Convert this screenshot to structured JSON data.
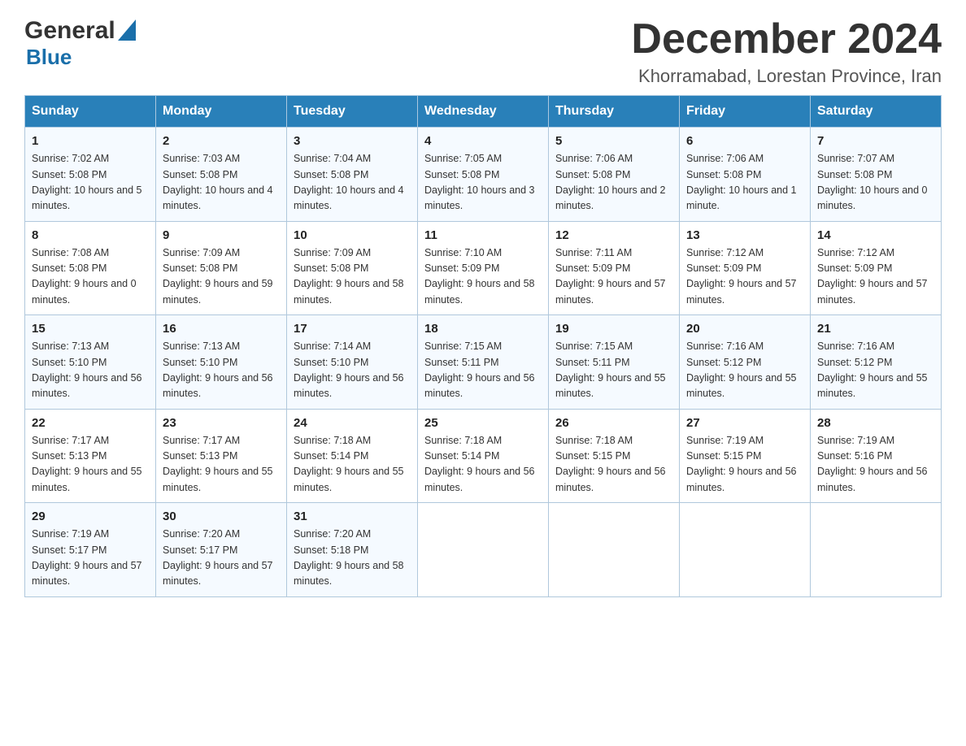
{
  "logo": {
    "general": "General",
    "triangle": "▲",
    "blue": "Blue"
  },
  "header": {
    "month_title": "December 2024",
    "location": "Khorramabad, Lorestan Province, Iran"
  },
  "days_of_week": [
    "Sunday",
    "Monday",
    "Tuesday",
    "Wednesday",
    "Thursday",
    "Friday",
    "Saturday"
  ],
  "weeks": [
    [
      {
        "day": "1",
        "sunrise": "7:02 AM",
        "sunset": "5:08 PM",
        "daylight": "10 hours and 5 minutes."
      },
      {
        "day": "2",
        "sunrise": "7:03 AM",
        "sunset": "5:08 PM",
        "daylight": "10 hours and 4 minutes."
      },
      {
        "day": "3",
        "sunrise": "7:04 AM",
        "sunset": "5:08 PM",
        "daylight": "10 hours and 4 minutes."
      },
      {
        "day": "4",
        "sunrise": "7:05 AM",
        "sunset": "5:08 PM",
        "daylight": "10 hours and 3 minutes."
      },
      {
        "day": "5",
        "sunrise": "7:06 AM",
        "sunset": "5:08 PM",
        "daylight": "10 hours and 2 minutes."
      },
      {
        "day": "6",
        "sunrise": "7:06 AM",
        "sunset": "5:08 PM",
        "daylight": "10 hours and 1 minute."
      },
      {
        "day": "7",
        "sunrise": "7:07 AM",
        "sunset": "5:08 PM",
        "daylight": "10 hours and 0 minutes."
      }
    ],
    [
      {
        "day": "8",
        "sunrise": "7:08 AM",
        "sunset": "5:08 PM",
        "daylight": "9 hours and 0 minutes."
      },
      {
        "day": "9",
        "sunrise": "7:09 AM",
        "sunset": "5:08 PM",
        "daylight": "9 hours and 59 minutes."
      },
      {
        "day": "10",
        "sunrise": "7:09 AM",
        "sunset": "5:08 PM",
        "daylight": "9 hours and 58 minutes."
      },
      {
        "day": "11",
        "sunrise": "7:10 AM",
        "sunset": "5:09 PM",
        "daylight": "9 hours and 58 minutes."
      },
      {
        "day": "12",
        "sunrise": "7:11 AM",
        "sunset": "5:09 PM",
        "daylight": "9 hours and 57 minutes."
      },
      {
        "day": "13",
        "sunrise": "7:12 AM",
        "sunset": "5:09 PM",
        "daylight": "9 hours and 57 minutes."
      },
      {
        "day": "14",
        "sunrise": "7:12 AM",
        "sunset": "5:09 PM",
        "daylight": "9 hours and 57 minutes."
      }
    ],
    [
      {
        "day": "15",
        "sunrise": "7:13 AM",
        "sunset": "5:10 PM",
        "daylight": "9 hours and 56 minutes."
      },
      {
        "day": "16",
        "sunrise": "7:13 AM",
        "sunset": "5:10 PM",
        "daylight": "9 hours and 56 minutes."
      },
      {
        "day": "17",
        "sunrise": "7:14 AM",
        "sunset": "5:10 PM",
        "daylight": "9 hours and 56 minutes."
      },
      {
        "day": "18",
        "sunrise": "7:15 AM",
        "sunset": "5:11 PM",
        "daylight": "9 hours and 56 minutes."
      },
      {
        "day": "19",
        "sunrise": "7:15 AM",
        "sunset": "5:11 PM",
        "daylight": "9 hours and 55 minutes."
      },
      {
        "day": "20",
        "sunrise": "7:16 AM",
        "sunset": "5:12 PM",
        "daylight": "9 hours and 55 minutes."
      },
      {
        "day": "21",
        "sunrise": "7:16 AM",
        "sunset": "5:12 PM",
        "daylight": "9 hours and 55 minutes."
      }
    ],
    [
      {
        "day": "22",
        "sunrise": "7:17 AM",
        "sunset": "5:13 PM",
        "daylight": "9 hours and 55 minutes."
      },
      {
        "day": "23",
        "sunrise": "7:17 AM",
        "sunset": "5:13 PM",
        "daylight": "9 hours and 55 minutes."
      },
      {
        "day": "24",
        "sunrise": "7:18 AM",
        "sunset": "5:14 PM",
        "daylight": "9 hours and 55 minutes."
      },
      {
        "day": "25",
        "sunrise": "7:18 AM",
        "sunset": "5:14 PM",
        "daylight": "9 hours and 56 minutes."
      },
      {
        "day": "26",
        "sunrise": "7:18 AM",
        "sunset": "5:15 PM",
        "daylight": "9 hours and 56 minutes."
      },
      {
        "day": "27",
        "sunrise": "7:19 AM",
        "sunset": "5:15 PM",
        "daylight": "9 hours and 56 minutes."
      },
      {
        "day": "28",
        "sunrise": "7:19 AM",
        "sunset": "5:16 PM",
        "daylight": "9 hours and 56 minutes."
      }
    ],
    [
      {
        "day": "29",
        "sunrise": "7:19 AM",
        "sunset": "5:17 PM",
        "daylight": "9 hours and 57 minutes."
      },
      {
        "day": "30",
        "sunrise": "7:20 AM",
        "sunset": "5:17 PM",
        "daylight": "9 hours and 57 minutes."
      },
      {
        "day": "31",
        "sunrise": "7:20 AM",
        "sunset": "5:18 PM",
        "daylight": "9 hours and 58 minutes."
      },
      null,
      null,
      null,
      null
    ]
  ],
  "labels": {
    "sunrise_prefix": "Sunrise: ",
    "sunset_prefix": "Sunset: ",
    "daylight_prefix": "Daylight: "
  }
}
